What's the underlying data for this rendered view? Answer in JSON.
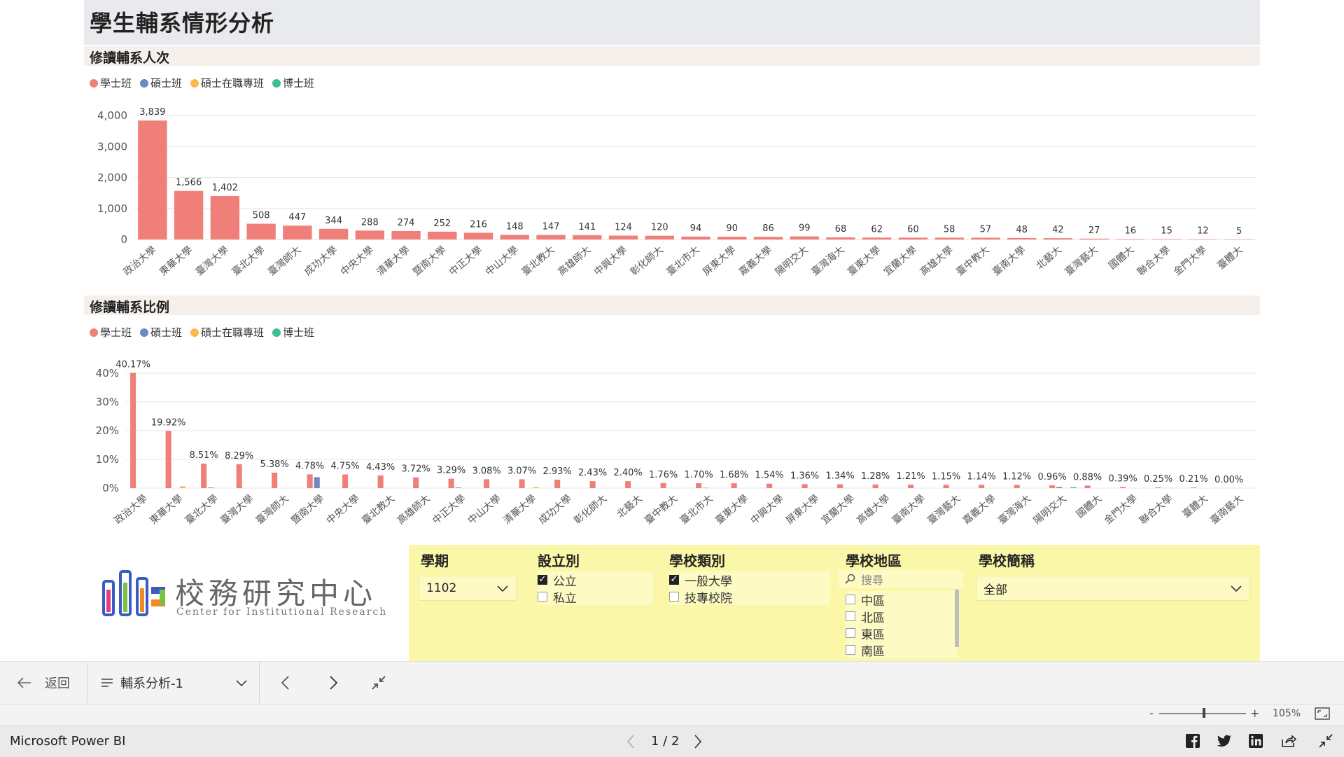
{
  "page": {
    "title": "學生輔系情形分析"
  },
  "chart1": {
    "section_title": "修讀輔系人次"
  },
  "chart2": {
    "section_title": "修讀輔系比例"
  },
  "legend": [
    {
      "label": "學士班",
      "color": "#f07f79"
    },
    {
      "label": "碩士班",
      "color": "#6e89be"
    },
    {
      "label": "碩士在職專班",
      "color": "#f8b94a"
    },
    {
      "label": "博士班",
      "color": "#3fbf8f"
    }
  ],
  "chart_data": [
    {
      "type": "bar",
      "title": "修讀輔系人次",
      "categories": [
        "政治大學",
        "東華大學",
        "臺灣大學",
        "臺北大學",
        "臺灣師大",
        "成功大學",
        "中央大學",
        "清華大學",
        "暨南大學",
        "中正大學",
        "中山大學",
        "臺北教大",
        "高雄師大",
        "中興大學",
        "彰化師大",
        "臺北市大",
        "屏東大學",
        "嘉義大學",
        "陽明交大",
        "臺灣海大",
        "臺東大學",
        "宜蘭大學",
        "高雄大學",
        "臺中教大",
        "臺南大學",
        "北藝大",
        "臺灣藝大",
        "國體大",
        "聯合大學",
        "金門大學",
        "臺體大"
      ],
      "values": [
        3839,
        1566,
        1402,
        508,
        447,
        344,
        288,
        274,
        252,
        216,
        148,
        147,
        141,
        124,
        120,
        94,
        90,
        86,
        99,
        68,
        62,
        60,
        58,
        57,
        48,
        42,
        27,
        16,
        15,
        12,
        5
      ],
      "value_labels": [
        "3,839",
        "1,566",
        "1,402",
        "508",
        "447",
        "344",
        "288",
        "274",
        "252",
        "216",
        "148",
        "147",
        "141",
        "124",
        "120",
        "94",
        "90",
        "86",
        "99",
        "68",
        "62",
        "60",
        "58",
        "57",
        "48",
        "42",
        "27",
        "16",
        "15",
        "12",
        "5"
      ],
      "yticks": [
        "0",
        "1,000",
        "2,000",
        "3,000",
        "4,000"
      ],
      "ylim": [
        0,
        4000
      ],
      "grid": true,
      "legend_position": "top-left"
    },
    {
      "type": "bar",
      "title": "修讀輔系比例",
      "categories": [
        "政治大學",
        "東華大學",
        "臺北大學",
        "臺灣大學",
        "臺灣師大",
        "暨南大學",
        "中央大學",
        "臺北教大",
        "高雄師大",
        "中正大學",
        "中山大學",
        "清華大學",
        "成功大學",
        "彰化師大",
        "北藝大",
        "臺中教大",
        "臺北市大",
        "臺東大學",
        "中興大學",
        "屏東大學",
        "宜蘭大學",
        "高雄大學",
        "臺南大學",
        "臺灣藝大",
        "嘉義大學",
        "臺灣海大",
        "陽明交大",
        "國體大",
        "金門大學",
        "聯合大學",
        "臺體大",
        "臺南藝大"
      ],
      "series": [
        {
          "name": "學士班",
          "values": [
            40.17,
            19.92,
            8.51,
            8.29,
            5.38,
            4.78,
            4.75,
            4.43,
            3.72,
            3.29,
            3.08,
            3.07,
            2.93,
            2.43,
            2.4,
            1.76,
            1.7,
            1.68,
            1.54,
            1.36,
            1.34,
            1.28,
            1.21,
            1.15,
            1.14,
            1.12,
            0.96,
            0.88,
            0.39,
            0.25,
            0.21,
            0.0
          ]
        },
        {
          "name": "碩士班",
          "values": [
            0,
            0,
            0.2,
            0,
            0,
            3.8,
            0,
            0,
            0,
            0.2,
            0,
            0,
            0,
            0,
            0,
            0,
            0.1,
            0,
            0,
            0,
            0,
            0,
            0,
            0,
            0,
            0,
            0.4,
            0,
            0,
            0,
            0,
            0
          ]
        },
        {
          "name": "碩士在職專班",
          "values": [
            0,
            0.6,
            0,
            0,
            0,
            0,
            0,
            0,
            0,
            0,
            0,
            0.3,
            0,
            0,
            0,
            0,
            0,
            0,
            0,
            0,
            0,
            0,
            0,
            0,
            0,
            0,
            0,
            0,
            0,
            0,
            0,
            0
          ]
        },
        {
          "name": "博士班",
          "values": [
            0,
            0,
            0,
            0,
            0,
            0,
            0,
            0,
            0,
            0,
            0,
            0,
            0,
            0,
            0,
            0,
            0,
            0,
            0,
            0,
            0,
            0,
            0,
            0,
            0,
            0,
            0.3,
            0,
            0,
            0,
            0,
            0
          ]
        }
      ],
      "value_labels": [
        "40.17%",
        "19.92%",
        "8.51%",
        "8.29%",
        "5.38%",
        "4.78%",
        "4.75%",
        "4.43%",
        "3.72%",
        "3.29%",
        "3.08%",
        "3.07%",
        "2.93%",
        "2.43%",
        "2.40%",
        "1.76%",
        "1.70%",
        "1.68%",
        "1.54%",
        "1.36%",
        "1.34%",
        "1.28%",
        "1.21%",
        "1.15%",
        "1.14%",
        "1.12%",
        "0.96%",
        "0.88%",
        "0.39%",
        "0.25%",
        "0.21%",
        "0.00%"
      ],
      "yticks": [
        "0%",
        "10%",
        "20%",
        "30%",
        "40%"
      ],
      "ylim": [
        0,
        40
      ],
      "grid": true,
      "legend_position": "top-left"
    }
  ],
  "logo": {
    "title": "校務研究中心",
    "subtitle": "Center for Institutional Research"
  },
  "slicers": {
    "semester": {
      "title": "學期",
      "value": "1102"
    },
    "establishment": {
      "title": "設立別",
      "options": [
        {
          "label": "公立",
          "checked": true
        },
        {
          "label": "私立",
          "checked": false
        }
      ]
    },
    "school_type": {
      "title": "學校類別",
      "options": [
        {
          "label": "一般大學",
          "checked": true
        },
        {
          "label": "技專校院",
          "checked": false
        }
      ]
    },
    "region": {
      "title": "學校地區",
      "search_placeholder": "搜尋",
      "options": [
        {
          "label": "中區"
        },
        {
          "label": "北區"
        },
        {
          "label": "東區"
        },
        {
          "label": "南區"
        }
      ]
    },
    "school_name": {
      "title": "學校簡稱",
      "value": "全部"
    }
  },
  "nav": {
    "back_label": "返回",
    "page_name": "輔系分析-1"
  },
  "zoom": {
    "level": "105%",
    "minus": "-",
    "plus": "+"
  },
  "footer": {
    "brand": "Microsoft Power BI",
    "page_indicator": "1 / 2"
  }
}
